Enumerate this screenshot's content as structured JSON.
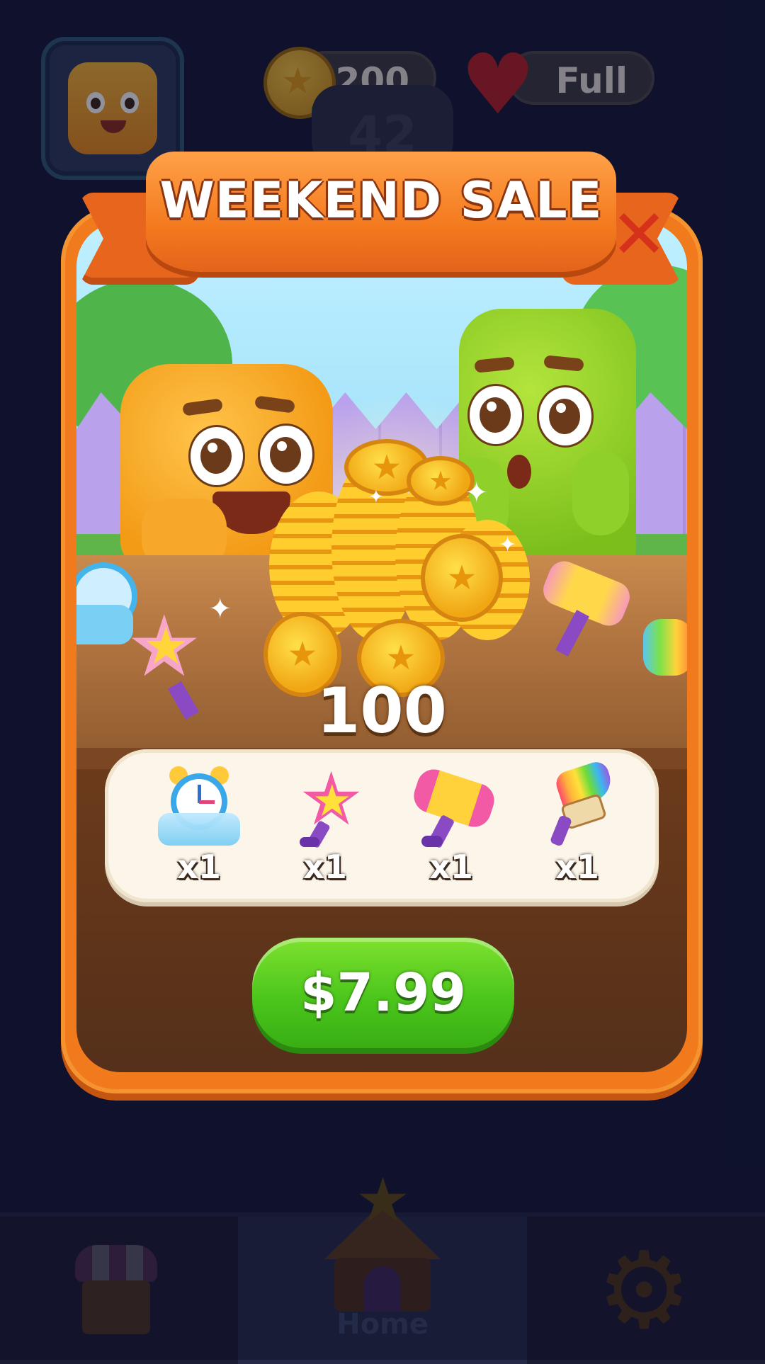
{
  "hud": {
    "coins": "200",
    "lives": "Full",
    "level": "42"
  },
  "popup": {
    "title": "WEEKEND SALE",
    "coin_amount": "100",
    "price": "$7.99",
    "rewards": [
      {
        "icon": "alarm-clock-icon",
        "quantity": "x1"
      },
      {
        "icon": "star-wand-icon",
        "quantity": "x1"
      },
      {
        "icon": "hammer-icon",
        "quantity": "x1"
      },
      {
        "icon": "paint-brush-icon",
        "quantity": "x1"
      }
    ]
  },
  "nav": {
    "tabs": [
      {
        "icon": "shop-icon",
        "label": ""
      },
      {
        "icon": "home-icon",
        "label": "Home",
        "active": true
      },
      {
        "icon": "gear-icon",
        "label": ""
      }
    ]
  },
  "colors": {
    "frame_orange": "#f07a1c",
    "buy_green": "#4cc61c",
    "close_red": "#d6321b",
    "background": "#141735"
  }
}
